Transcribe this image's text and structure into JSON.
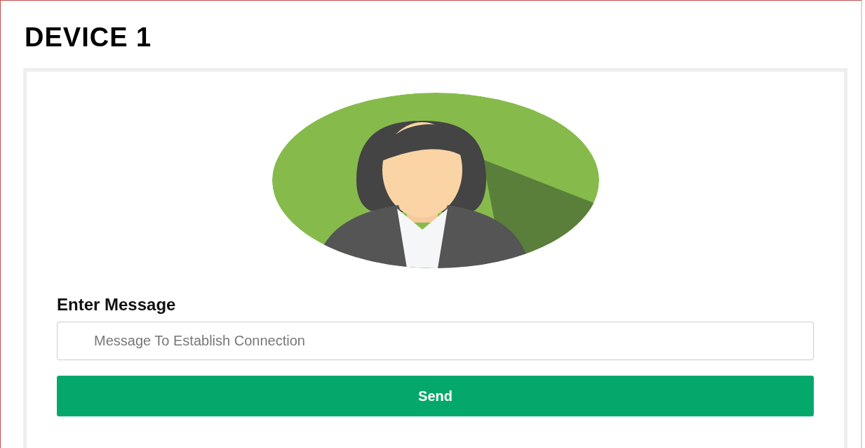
{
  "title": "DEVICE 1",
  "message": {
    "label": "Enter Message",
    "placeholder": "Message To Establish Connection"
  },
  "send_button": {
    "label": "Send"
  }
}
